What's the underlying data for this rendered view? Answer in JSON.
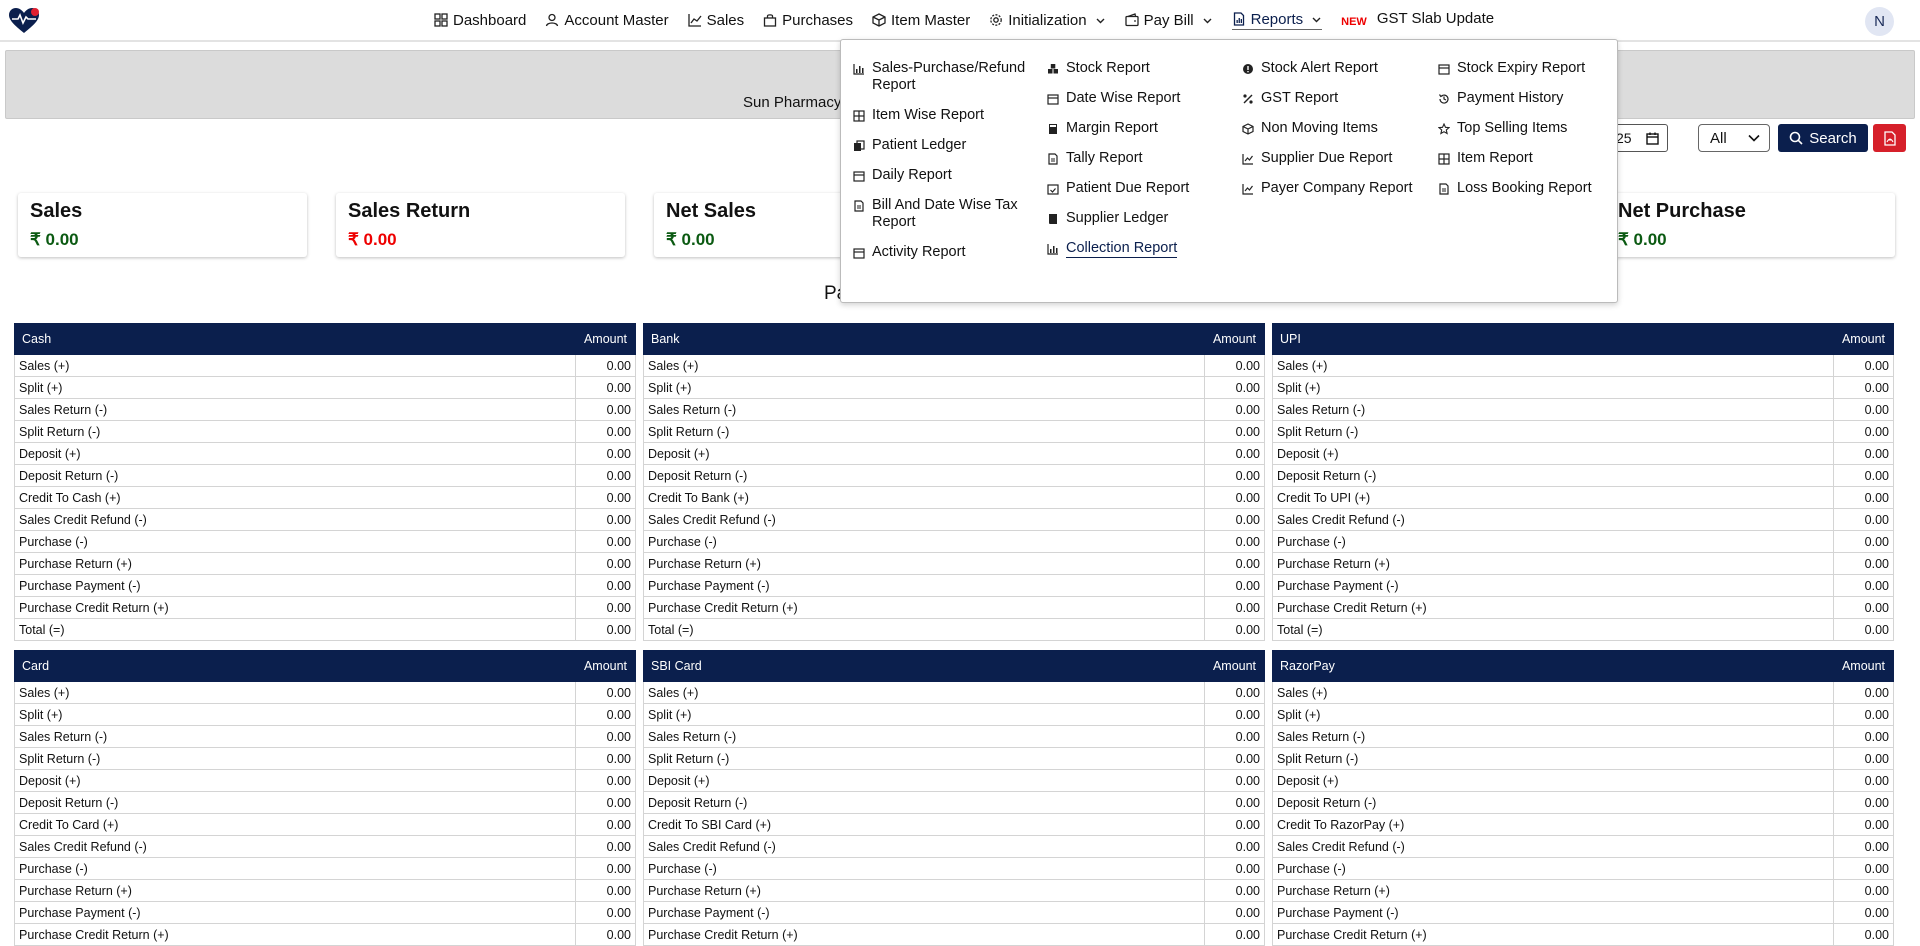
{
  "nav": {
    "items": [
      {
        "label": "Dashboard",
        "icon": "grid-icon"
      },
      {
        "label": "Account Master",
        "icon": "user-icon"
      },
      {
        "label": "Sales",
        "icon": "chart-icon"
      },
      {
        "label": "Purchases",
        "icon": "bag-icon"
      },
      {
        "label": "Item Master",
        "icon": "box-icon"
      },
      {
        "label": "Initialization",
        "icon": "gear-icon"
      },
      {
        "label": "Pay Bill",
        "icon": "wallet-icon"
      },
      {
        "label": "Reports",
        "icon": "report-icon"
      }
    ],
    "new_badge": "NEW",
    "gst_link": "GST Slab Update",
    "avatar_initial": "N"
  },
  "banner": {
    "text": "Sun Pharmacy"
  },
  "filters": {
    "date_value": "25",
    "select_value": "All",
    "search_label": "Search"
  },
  "cards": [
    {
      "title": "Sales",
      "value": "₹ 0.00"
    },
    {
      "title": "Sales Return",
      "value": "₹ 0.00"
    },
    {
      "title": "Net Sales",
      "value": "₹ 0.00"
    },
    {
      "title": "Net Purchase",
      "value": "₹ 0.00"
    }
  ],
  "section": {
    "heading": "Pa"
  },
  "tables": [
    {
      "title": "Cash",
      "amount_label": "Amount",
      "rows": [
        {
          "label": "Sales (+)",
          "value": "0.00"
        },
        {
          "label": "Split (+)",
          "value": "0.00"
        },
        {
          "label": "Sales Return (-)",
          "value": "0.00"
        },
        {
          "label": "Split Return (-)",
          "value": "0.00"
        },
        {
          "label": "Deposit (+)",
          "value": "0.00"
        },
        {
          "label": "Deposit Return (-)",
          "value": "0.00"
        },
        {
          "label": "Credit To Cash (+)",
          "value": "0.00"
        },
        {
          "label": "Sales Credit Refund (-)",
          "value": "0.00"
        },
        {
          "label": "Purchase (-)",
          "value": "0.00"
        },
        {
          "label": "Purchase Return (+)",
          "value": "0.00"
        },
        {
          "label": "Purchase Payment (-)",
          "value": "0.00"
        },
        {
          "label": "Purchase Credit Return (+)",
          "value": "0.00"
        },
        {
          "label": "Total (=)",
          "value": "0.00"
        }
      ]
    },
    {
      "title": "Bank",
      "amount_label": "Amount",
      "rows": [
        {
          "label": "Sales (+)",
          "value": "0.00"
        },
        {
          "label": "Split (+)",
          "value": "0.00"
        },
        {
          "label": "Sales Return (-)",
          "value": "0.00"
        },
        {
          "label": "Split Return (-)",
          "value": "0.00"
        },
        {
          "label": "Deposit (+)",
          "value": "0.00"
        },
        {
          "label": "Deposit Return (-)",
          "value": "0.00"
        },
        {
          "label": "Credit To Bank (+)",
          "value": "0.00"
        },
        {
          "label": "Sales Credit Refund (-)",
          "value": "0.00"
        },
        {
          "label": "Purchase (-)",
          "value": "0.00"
        },
        {
          "label": "Purchase Return (+)",
          "value": "0.00"
        },
        {
          "label": "Purchase Payment (-)",
          "value": "0.00"
        },
        {
          "label": "Purchase Credit Return (+)",
          "value": "0.00"
        },
        {
          "label": "Total (=)",
          "value": "0.00"
        }
      ]
    },
    {
      "title": "UPI",
      "amount_label": "Amount",
      "rows": [
        {
          "label": "Sales (+)",
          "value": "0.00"
        },
        {
          "label": "Split (+)",
          "value": "0.00"
        },
        {
          "label": "Sales Return (-)",
          "value": "0.00"
        },
        {
          "label": "Split Return (-)",
          "value": "0.00"
        },
        {
          "label": "Deposit (+)",
          "value": "0.00"
        },
        {
          "label": "Deposit Return (-)",
          "value": "0.00"
        },
        {
          "label": "Credit To UPI (+)",
          "value": "0.00"
        },
        {
          "label": "Sales Credit Refund (-)",
          "value": "0.00"
        },
        {
          "label": "Purchase (-)",
          "value": "0.00"
        },
        {
          "label": "Purchase Return (+)",
          "value": "0.00"
        },
        {
          "label": "Purchase Payment (-)",
          "value": "0.00"
        },
        {
          "label": "Purchase Credit Return (+)",
          "value": "0.00"
        },
        {
          "label": "Total (=)",
          "value": "0.00"
        }
      ]
    },
    {
      "title": "Card",
      "amount_label": "Amount",
      "rows": [
        {
          "label": "Sales (+)",
          "value": "0.00"
        },
        {
          "label": "Split (+)",
          "value": "0.00"
        },
        {
          "label": "Sales Return (-)",
          "value": "0.00"
        },
        {
          "label": "Split Return (-)",
          "value": "0.00"
        },
        {
          "label": "Deposit (+)",
          "value": "0.00"
        },
        {
          "label": "Deposit Return (-)",
          "value": "0.00"
        },
        {
          "label": "Credit To Card (+)",
          "value": "0.00"
        },
        {
          "label": "Sales Credit Refund (-)",
          "value": "0.00"
        },
        {
          "label": "Purchase (-)",
          "value": "0.00"
        },
        {
          "label": "Purchase Return (+)",
          "value": "0.00"
        },
        {
          "label": "Purchase Payment (-)",
          "value": "0.00"
        },
        {
          "label": "Purchase Credit Return (+)",
          "value": "0.00"
        }
      ]
    },
    {
      "title": "SBI Card",
      "amount_label": "Amount",
      "rows": [
        {
          "label": "Sales (+)",
          "value": "0.00"
        },
        {
          "label": "Split (+)",
          "value": "0.00"
        },
        {
          "label": "Sales Return (-)",
          "value": "0.00"
        },
        {
          "label": "Split Return (-)",
          "value": "0.00"
        },
        {
          "label": "Deposit (+)",
          "value": "0.00"
        },
        {
          "label": "Deposit Return (-)",
          "value": "0.00"
        },
        {
          "label": "Credit To SBI Card (+)",
          "value": "0.00"
        },
        {
          "label": "Sales Credit Refund (-)",
          "value": "0.00"
        },
        {
          "label": "Purchase (-)",
          "value": "0.00"
        },
        {
          "label": "Purchase Return (+)",
          "value": "0.00"
        },
        {
          "label": "Purchase Payment (-)",
          "value": "0.00"
        },
        {
          "label": "Purchase Credit Return (+)",
          "value": "0.00"
        }
      ]
    },
    {
      "title": "RazorPay",
      "amount_label": "Amount",
      "rows": [
        {
          "label": "Sales (+)",
          "value": "0.00"
        },
        {
          "label": "Split (+)",
          "value": "0.00"
        },
        {
          "label": "Sales Return (-)",
          "value": "0.00"
        },
        {
          "label": "Split Return (-)",
          "value": "0.00"
        },
        {
          "label": "Deposit (+)",
          "value": "0.00"
        },
        {
          "label": "Deposit Return (-)",
          "value": "0.00"
        },
        {
          "label": "Credit To RazorPay (+)",
          "value": "0.00"
        },
        {
          "label": "Sales Credit Refund (-)",
          "value": "0.00"
        },
        {
          "label": "Purchase (-)",
          "value": "0.00"
        },
        {
          "label": "Purchase Return (+)",
          "value": "0.00"
        },
        {
          "label": "Purchase Payment (-)",
          "value": "0.00"
        },
        {
          "label": "Purchase Credit Return (+)",
          "value": "0.00"
        }
      ]
    }
  ],
  "reports_menu": {
    "columns": [
      [
        {
          "label": "Sales-Purchase/Refund Report",
          "icon": "bar-chart-icon"
        },
        {
          "label": "Item Wise Report",
          "icon": "grid-icon"
        },
        {
          "label": "Patient Ledger",
          "icon": "copy-icon"
        },
        {
          "label": "Daily Report",
          "icon": "calendar-icon"
        },
        {
          "label": "Bill And Date Wise Tax Report",
          "icon": "file-icon"
        },
        {
          "label": "Activity Report",
          "icon": "calendar-icon"
        }
      ],
      [
        {
          "label": "Stock Report",
          "icon": "boxes-icon"
        },
        {
          "label": "Date Wise Report",
          "icon": "calendar-icon"
        },
        {
          "label": "Margin Report",
          "icon": "calculator-icon"
        },
        {
          "label": "Tally Report",
          "icon": "file-icon"
        },
        {
          "label": "Patient Due Report",
          "icon": "calendar-check-icon"
        },
        {
          "label": "Supplier Ledger",
          "icon": "book-icon"
        },
        {
          "label": "Collection Report",
          "icon": "bar-chart-icon"
        }
      ],
      [
        {
          "label": "Stock Alert Report",
          "icon": "alert-icon"
        },
        {
          "label": "GST Report",
          "icon": "percent-icon"
        },
        {
          "label": "Non Moving Items",
          "icon": "box-icon"
        },
        {
          "label": "Supplier Due Report",
          "icon": "line-chart-icon"
        },
        {
          "label": "Payer Company Report",
          "icon": "line-chart-icon"
        }
      ],
      [
        {
          "label": "Stock Expiry Report",
          "icon": "calendar-icon"
        },
        {
          "label": "Payment History",
          "icon": "history-icon"
        },
        {
          "label": "Top Selling Items",
          "icon": "star-icon"
        },
        {
          "label": "Item Report",
          "icon": "grid-icon"
        },
        {
          "label": "Loss Booking Report",
          "icon": "file-icon"
        }
      ]
    ]
  },
  "colors": {
    "navy": "#0b1f4d",
    "green": "#0b5a12",
    "red": "#e00000",
    "pdf_red": "#d6202a"
  }
}
